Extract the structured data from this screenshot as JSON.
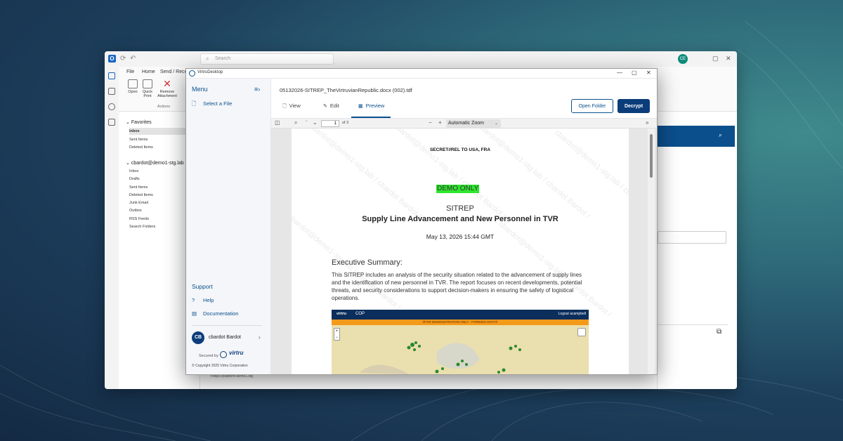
{
  "outlook": {
    "search_placeholder": "Search",
    "avatar_initials": "CE",
    "menu": [
      "File",
      "Home",
      "Send / Recei"
    ],
    "ribbon_buttons": [
      "Open",
      "Quick Print",
      "Remove Attachment"
    ],
    "ribbon_group": "Actions",
    "favorites_header": "Favorites",
    "favorites": [
      "Inbox",
      "Sent Items",
      "Deleted Items"
    ],
    "account_header": "cbardot@demo1-stg.lab",
    "account_folders": [
      "Inbox",
      "Drafts",
      "Sent Items",
      "Deleted Items",
      "Junk Email",
      "Outbox",
      "RSS Feeds",
      "Search Folders"
    ],
    "url_text": "<https://platform-demo1.stg"
  },
  "virtru": {
    "window_title": "VirtruDesktop",
    "sidebar": {
      "menu_title": "Menu",
      "select_file": "Select a File",
      "support_title": "Support",
      "help": "Help",
      "documentation": "Documentation",
      "user_initials": "CB",
      "user_name": "cbardot Bardot",
      "secured_by": "Secured by",
      "brand": "virtru",
      "copyright": "© Copyright 2025 Virtru Corporation"
    },
    "main": {
      "filename": "05132026-SITREP_TheVirtruvianRepublic.docx (002).tdf",
      "tabs": [
        {
          "label": "View"
        },
        {
          "label": "Edit"
        },
        {
          "label": "Preview",
          "active": true
        }
      ],
      "open_folder": "Open Folder",
      "decrypt": "Decrypt"
    },
    "pdf_toolbar": {
      "page": "1",
      "of_pages": "of 3",
      "zoom": "Automatic Zoom"
    },
    "document": {
      "classification": "SECRET//REL TO USA, FRA",
      "demo_label": "DEMO ONLY",
      "title": "SITREP",
      "subtitle": "Supply Line Advancement and New Personnel in TVR",
      "date": "May 13, 2026 15:44 GMT",
      "section_heading": "Executive Summary:",
      "summary": "This SITREP includes an analysis of the security situation related to the advancement of supply lines and the identification of new personnel in TVR. The report focuses on recent developments, potential threats, and security considerations to support decision-makers in ensuring the safety of logistical operations.",
      "watermark": "cbardot@demo1-stg.lab / cbardot Bardot /",
      "map": {
        "brand": "virtru",
        "title": "COP",
        "logout": "Logout acampbell",
        "banner": "//FOR DEMONSTRATION ONLY - FOREIGN GOVT//"
      }
    }
  }
}
